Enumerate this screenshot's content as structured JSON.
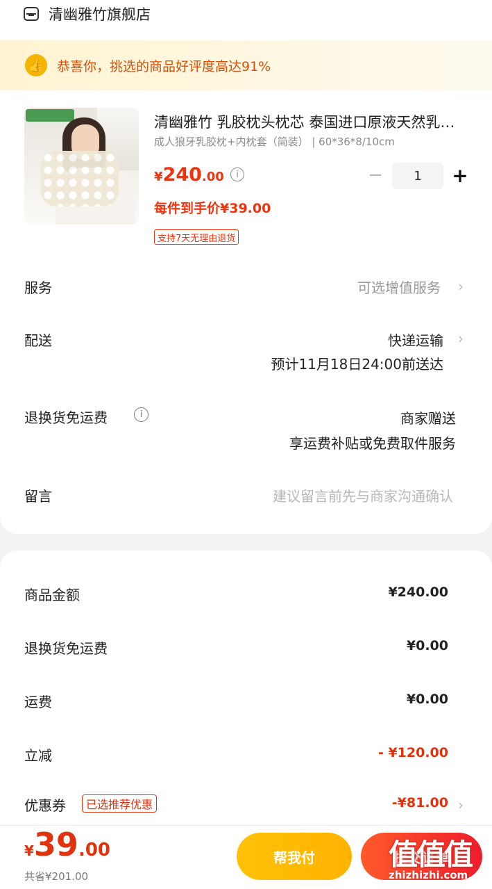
{
  "store": {
    "name": "清幽雅竹旗舰店",
    "icon": "store-icon"
  },
  "banner": {
    "text": "恭喜你，挑选的商品好评度高达91%",
    "icon": "thumbs-up-icon"
  },
  "product": {
    "title": "清幽雅竹 乳胶枕头枕芯 泰国进口原液天然乳胶枕",
    "spec": "成人狼牙乳胶枕+内枕套（简装） | 60*36*8/10cm",
    "price_symbol": "¥",
    "price_int": "240",
    "price_dec": ".00",
    "quantity": "1",
    "unit_price_text": "每件到手价¥39.00",
    "return_badge": "支持7天无理由退货"
  },
  "rows": {
    "service": {
      "label": "服务",
      "value": "可选增值服务"
    },
    "delivery": {
      "label": "配送",
      "value": "快递运输",
      "eta": "预计11月18日24:00前送达"
    },
    "return_shipping": {
      "label": "退换货免运费",
      "value": "商家赠送",
      "detail": "享运费补贴或免费取件服务"
    },
    "message": {
      "label": "留言",
      "placeholder": "建议留言前先与商家沟通确认"
    }
  },
  "amounts": {
    "goods": {
      "label": "商品金额",
      "value": "¥240.00"
    },
    "return_fee": {
      "label": "退换货免运费",
      "value": "¥0.00"
    },
    "shipping": {
      "label": "运费",
      "value": "¥0.00"
    },
    "discount": {
      "label": "立减",
      "value": "- ¥120.00"
    },
    "coupon": {
      "label": "优惠券",
      "tag": "已选推荐优惠",
      "value": "-¥81.00"
    }
  },
  "bottom": {
    "total_symbol": "¥",
    "total_int": "39",
    "total_dec": ".00",
    "saved": "共省¥201.00",
    "pay_for_me": "帮我付",
    "submit": "提交订单"
  },
  "watermark": {
    "main": "值值值",
    "sub": "zhizhizhi.com"
  },
  "colors": {
    "accent_red": "#f0330d",
    "accent_yellow": "#ffc107",
    "banner_text": "#d4500a"
  }
}
